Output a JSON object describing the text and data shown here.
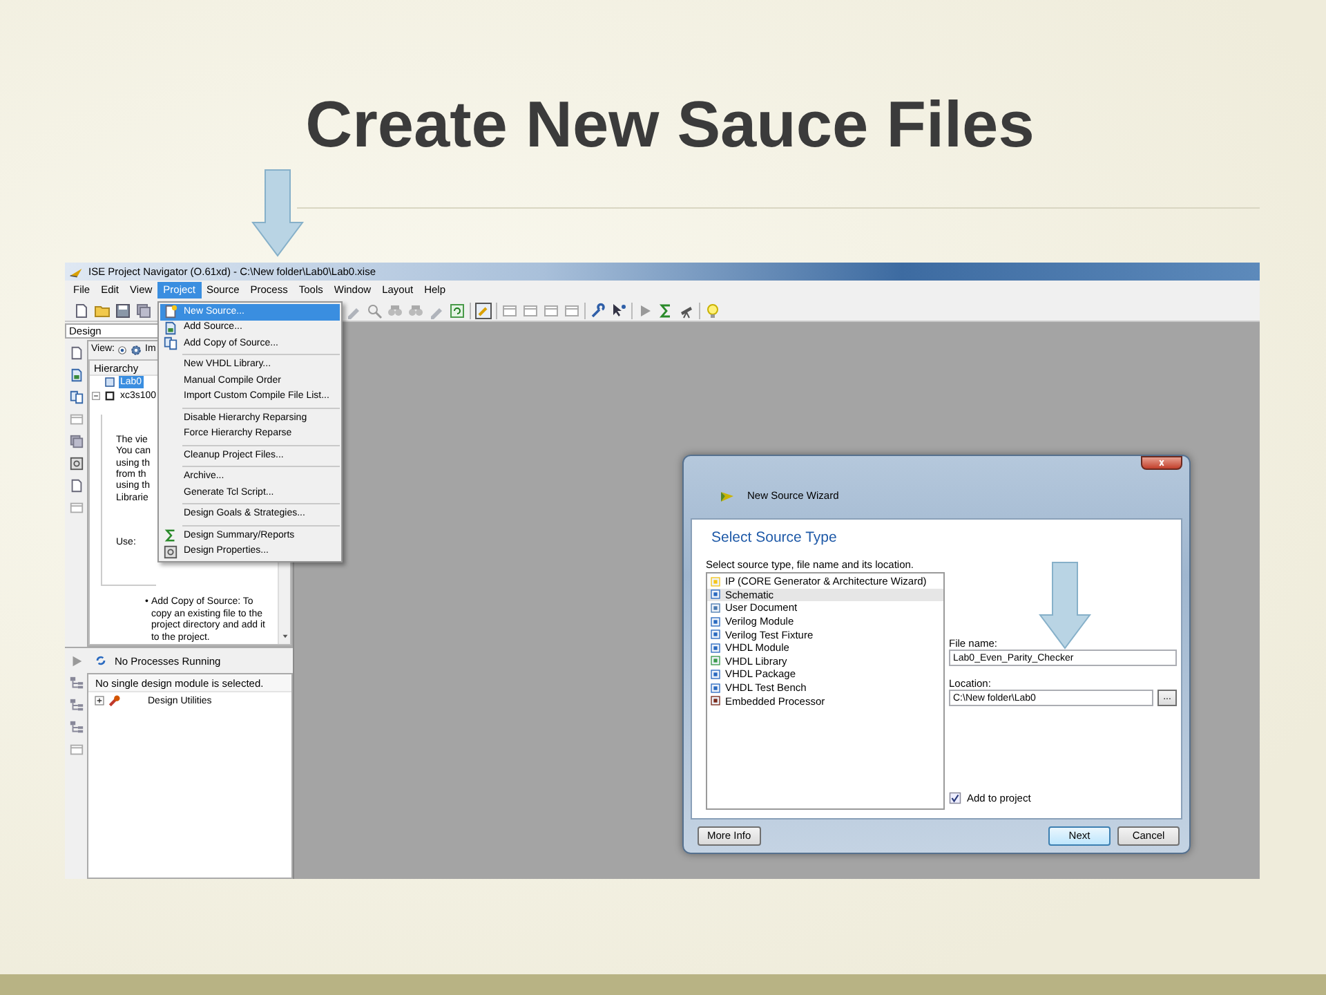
{
  "slide": {
    "title": "Create New Sauce Files"
  },
  "window": {
    "title": "ISE Project Navigator (O.61xd) - C:\\New folder\\Lab0\\Lab0.xise",
    "menu": [
      {
        "label": "File",
        "selected": false
      },
      {
        "label": "Edit",
        "selected": false
      },
      {
        "label": "View",
        "selected": false
      },
      {
        "label": "Project",
        "selected": true
      },
      {
        "label": "Source",
        "selected": false
      },
      {
        "label": "Process",
        "selected": false
      },
      {
        "label": "Tools",
        "selected": false
      },
      {
        "label": "Window",
        "selected": false
      },
      {
        "label": "Layout",
        "selected": false
      },
      {
        "label": "Help",
        "selected": false
      }
    ]
  },
  "project_menu": [
    {
      "kind": "item",
      "label": "New Source...",
      "selected": true
    },
    {
      "kind": "item",
      "label": "Add Source...",
      "selected": false
    },
    {
      "kind": "item",
      "label": "Add Copy of Source...",
      "selected": false
    },
    {
      "kind": "separator"
    },
    {
      "kind": "item",
      "label": "New VHDL Library...",
      "selected": false
    },
    {
      "kind": "item",
      "label": "Manual Compile Order",
      "selected": false
    },
    {
      "kind": "item",
      "label": "Import Custom Compile File List...",
      "selected": false
    },
    {
      "kind": "separator"
    },
    {
      "kind": "item",
      "label": "Disable Hierarchy Reparsing",
      "selected": false
    },
    {
      "kind": "item",
      "label": "Force Hierarchy Reparse",
      "selected": false
    },
    {
      "kind": "separator"
    },
    {
      "kind": "item",
      "label": "Cleanup Project Files...",
      "selected": false
    },
    {
      "kind": "separator"
    },
    {
      "kind": "item",
      "label": "Archive...",
      "selected": false
    },
    {
      "kind": "item",
      "label": "Generate Tcl Script...",
      "selected": false
    },
    {
      "kind": "separator"
    },
    {
      "kind": "item",
      "label": "Design Goals & Strategies...",
      "selected": false
    },
    {
      "kind": "separator"
    },
    {
      "kind": "item",
      "label": "Design Summary/Reports",
      "selected": false
    },
    {
      "kind": "item",
      "label": "Design Properties...",
      "selected": false
    }
  ],
  "design_panel": {
    "dropdown": "Design",
    "view_label": "View:",
    "view_option": "Im",
    "hierarchy_heading": "Hierarchy",
    "tree": [
      {
        "label": "Lab0",
        "selected": true
      },
      {
        "label": "xc3s100",
        "selected": false,
        "expanded": true
      }
    ],
    "help_lines": [
      "The vie",
      "You can",
      "using th",
      "from th",
      "using th",
      "Librarie"
    ],
    "use_label": "Use:",
    "bullet": "•",
    "bullet_text": "Add Copy of Source: To copy an existing file to the project directory and add it to the project."
  },
  "process_panel": {
    "status": "No Processes Running",
    "message": "No single design module is selected.",
    "tree": [
      {
        "label": "Design Utilities",
        "expanded": false
      }
    ]
  },
  "dialog": {
    "title": "New Source Wizard",
    "heading": "Select Source Type",
    "instruction": "Select source type, file name and its location.",
    "source_types": [
      {
        "label": "IP (CORE Generator & Architecture Wizard)",
        "selected": false
      },
      {
        "label": "Schematic",
        "selected": true
      },
      {
        "label": "User Document",
        "selected": false
      },
      {
        "label": "Verilog Module",
        "selected": false
      },
      {
        "label": "Verilog Test Fixture",
        "selected": false
      },
      {
        "label": "VHDL Module",
        "selected": false
      },
      {
        "label": "VHDL Library",
        "selected": false
      },
      {
        "label": "VHDL Package",
        "selected": false
      },
      {
        "label": "VHDL Test Bench",
        "selected": false
      },
      {
        "label": "Embedded Processor",
        "selected": false
      }
    ],
    "file_name_label": "File name:",
    "file_name": "Lab0_Even_Parity_Checker",
    "location_label": "Location:",
    "location": "C:\\New folder\\Lab0",
    "browse": "...",
    "add_to_project": {
      "label": "Add to project",
      "checked": true
    },
    "buttons": [
      {
        "label": "More Info",
        "default": false
      },
      {
        "label": "Next",
        "default": true
      },
      {
        "label": "Cancel",
        "default": false
      }
    ]
  }
}
